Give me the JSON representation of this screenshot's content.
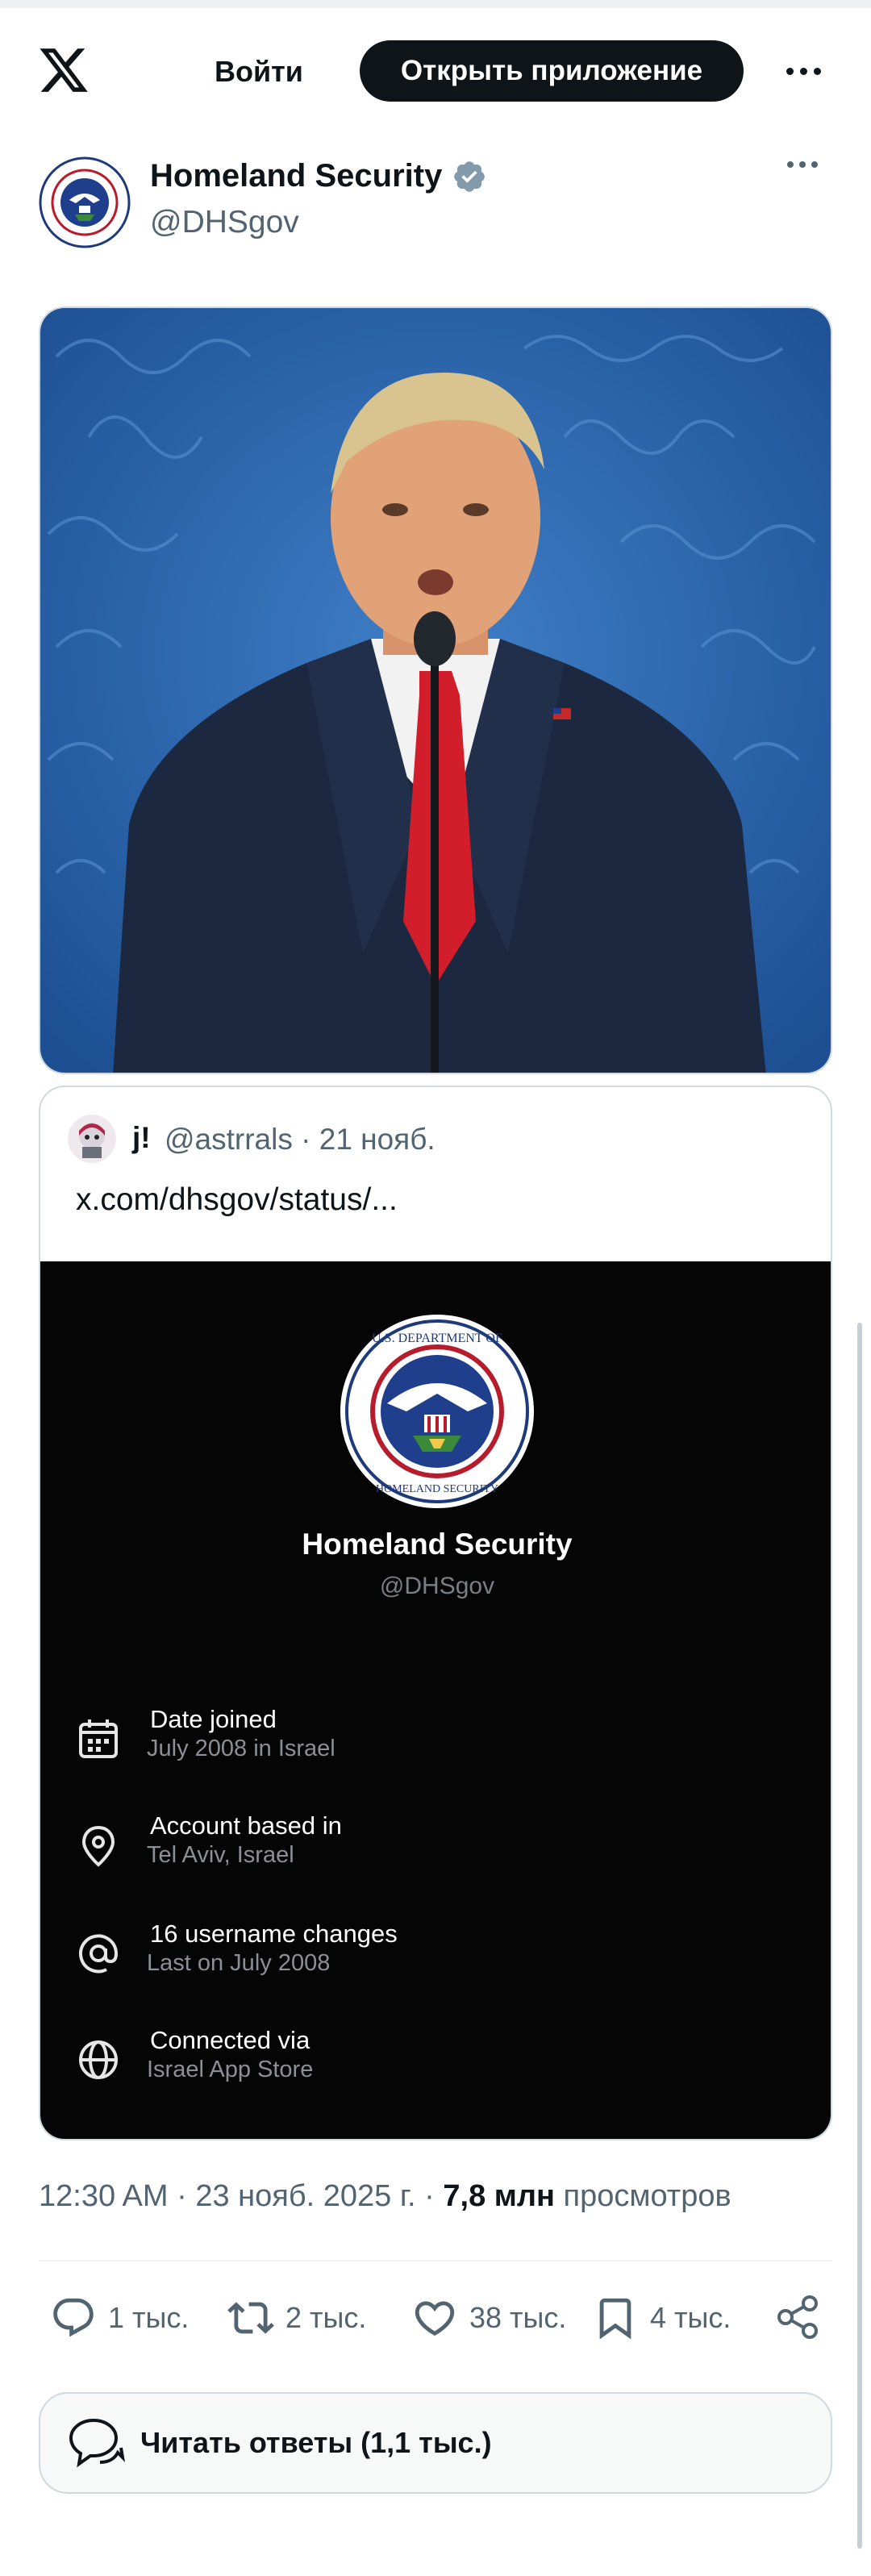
{
  "topbar": {
    "login_label": "Войти",
    "open_app_label": "Открыть приложение"
  },
  "author": {
    "name": "Homeland Security",
    "handle": "@DHSgov",
    "verified_icon": "verified-badge-icon",
    "verified_color": "#829aab"
  },
  "quote": {
    "name": "j!",
    "meta": "@astrrals · 21 нояб.",
    "link": "x.com/dhsgov/status/...",
    "card": {
      "name": "Homeland Security",
      "handle": "@DHSgov",
      "rows": [
        {
          "icon": "calendar-icon",
          "title": "Date joined",
          "sub": "July 2008 in Israel"
        },
        {
          "icon": "location-pin-icon",
          "title": "Account based in",
          "sub": "Tel Aviv, Israel"
        },
        {
          "icon": "at-sign-icon",
          "title": "16 username changes",
          "sub": "Last on July 2008"
        },
        {
          "icon": "globe-icon",
          "title": "Connected via",
          "sub": "Israel App Store"
        }
      ]
    }
  },
  "post": {
    "time": "12:30 AM · 23 нояб. 2025 г. · ",
    "views_count": "7,8 млн",
    "views_label": " просмотров"
  },
  "actions": {
    "replies": "1 тыс.",
    "reposts": "2 тыс.",
    "likes": "38 тыс.",
    "bookmarks": "4 тыс."
  },
  "read_replies_label": "Читать ответы (1,1 тыс.)",
  "colors": {
    "text": "#0f1419",
    "secondary": "#536471",
    "border": "#cfd9de"
  }
}
